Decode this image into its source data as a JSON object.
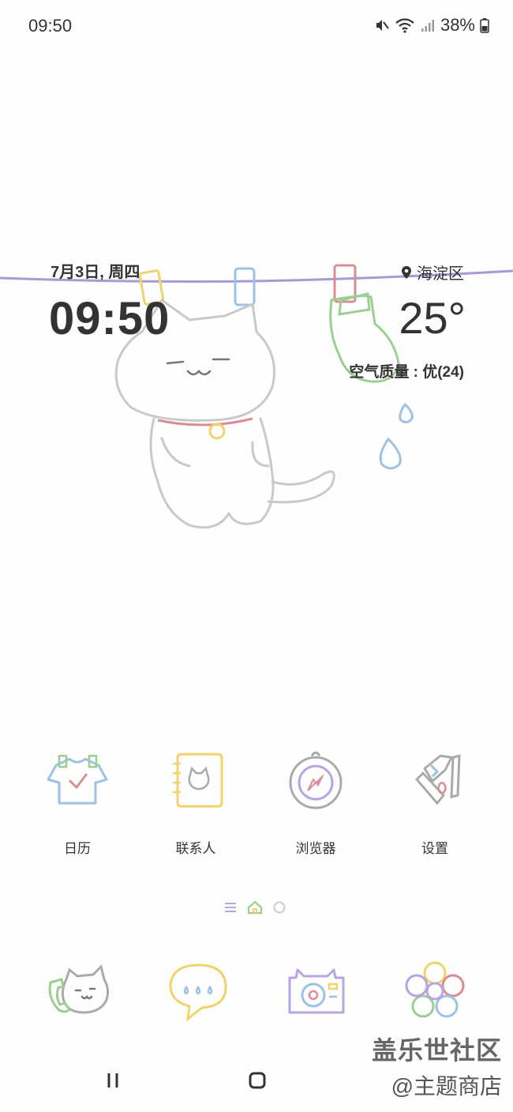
{
  "status_bar": {
    "time": "09:50",
    "battery": "38%",
    "icons": [
      "mute-icon",
      "wifi-icon",
      "signal-icon",
      "battery-icon"
    ]
  },
  "widget": {
    "date": "7月3日, 周四",
    "time": "09:50",
    "location": "海淀区",
    "temperature": "25°",
    "air_quality": "空气质量 : 优(24)"
  },
  "apps": [
    {
      "label": "日历",
      "icon": "tshirt-calendar-icon"
    },
    {
      "label": "联系人",
      "icon": "notebook-contacts-icon"
    },
    {
      "label": "浏览器",
      "icon": "compass-browser-icon"
    },
    {
      "label": "设置",
      "icon": "settings-icon"
    }
  ],
  "page_indicator": {
    "pages": 3,
    "current": 2
  },
  "dock": [
    {
      "icon": "cat-phone-icon"
    },
    {
      "icon": "speech-bubble-messages-icon"
    },
    {
      "icon": "cat-camera-icon"
    },
    {
      "icon": "flower-gallery-icon"
    }
  ],
  "watermark": {
    "line1": "盖乐世社区",
    "line2": "@主题商店"
  },
  "colors": {
    "line": "#a99ad6",
    "text": "#333333",
    "blue": "#9cc3e6",
    "yellow": "#f1d36b",
    "pink": "#d98d94",
    "green": "#9ccf8f",
    "purple": "#b8a4e3"
  }
}
